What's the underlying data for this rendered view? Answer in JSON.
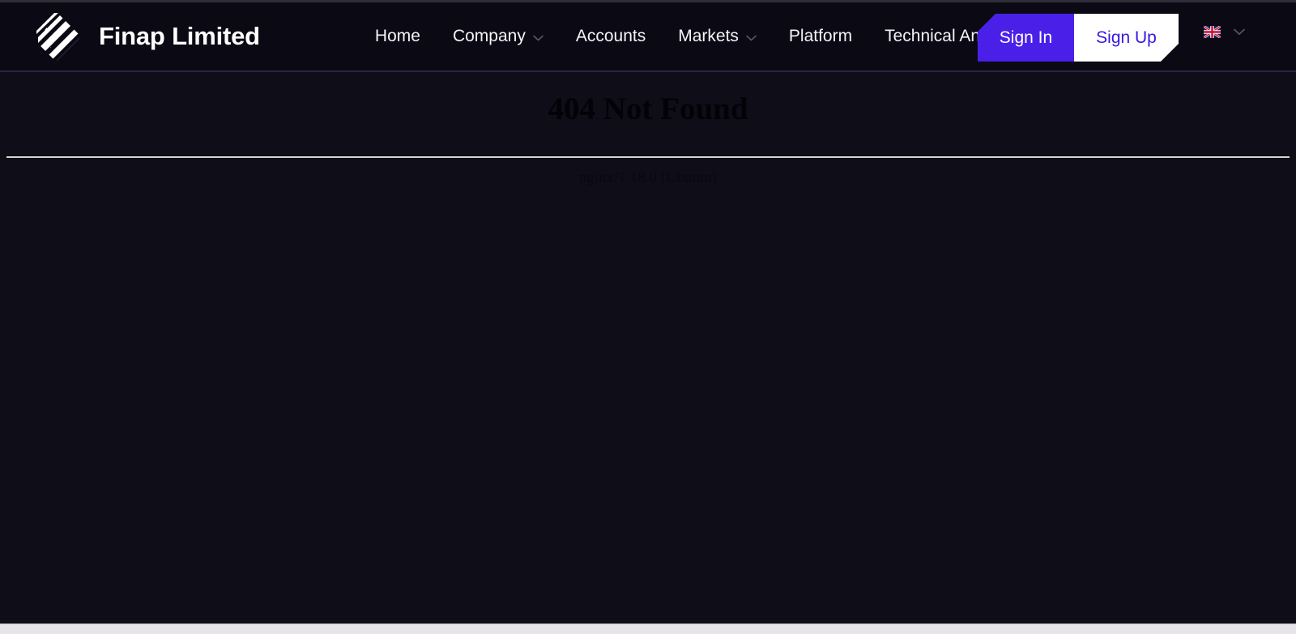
{
  "brand": {
    "name": "Finap Limited",
    "logo_icon": "finap-diamond-logo"
  },
  "nav": {
    "items": [
      {
        "label": "Home",
        "has_dropdown": false,
        "icon": ""
      },
      {
        "label": "Company",
        "has_dropdown": true,
        "icon": "chevron-down-icon"
      },
      {
        "label": "Accounts",
        "has_dropdown": false,
        "icon": ""
      },
      {
        "label": "Markets",
        "has_dropdown": true,
        "icon": "chevron-down-icon"
      },
      {
        "label": "Platform",
        "has_dropdown": false,
        "icon": ""
      },
      {
        "label": "Technical Analysis",
        "has_dropdown": false,
        "icon": ""
      }
    ]
  },
  "auth": {
    "sign_in_label": "Sign In",
    "sign_up_label": "Sign Up",
    "sign_in_bg": "#4A20E8",
    "sign_in_text": "#FFFFFF",
    "sign_up_bg": "#FFFFFF",
    "sign_up_text": "#3A16E0"
  },
  "language": {
    "flag_icon": "uk-flag-icon",
    "selected": "EN",
    "chevron_icon": "chevron-down-icon"
  },
  "error_page": {
    "title": "404 Not Found",
    "server_signature": "nginx/1.18.0 (Ubuntu)"
  },
  "theme": {
    "page_bg": "#0E0D18",
    "header_bg": "#0B0A14",
    "header_border": "#2A2440",
    "accent": "#4A20E8",
    "nav_text": "#F4F4F7"
  }
}
